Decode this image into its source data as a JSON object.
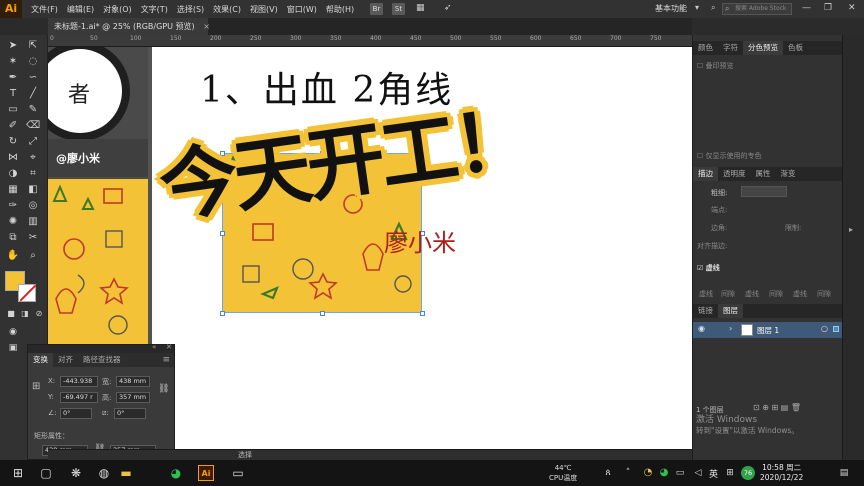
{
  "app": {
    "logo": "Ai"
  },
  "menu": [
    "文件(F)",
    "编辑(E)",
    "对象(O)",
    "文字(T)",
    "选择(S)",
    "效果(C)",
    "视图(V)",
    "窗口(W)",
    "帮助(H)"
  ],
  "menu_badges": [
    "Br",
    "St"
  ],
  "workspace": "基本功能",
  "stock_search_placeholder": "搜索 Adobe Stock",
  "document_tab": {
    "title": "未标题-1.ai* @ 25% (RGB/GPU 预览)",
    "close": "×"
  },
  "ruler_ticks": [
    "0",
    "50",
    "100",
    "150",
    "200",
    "250",
    "300",
    "350",
    "400",
    "450",
    "500",
    "550",
    "600",
    "650",
    "700",
    "750"
  ],
  "canvas": {
    "stamp_char": "者",
    "brand": "@廖小米",
    "title": "1、出血 2角线",
    "headline": "今天开工！",
    "red_text": "廖小米"
  },
  "colors": {
    "fill": "#f4c236",
    "accent": "#ff9a00",
    "layer_highlight": "#3f5a78"
  },
  "panels": {
    "top_tabs": [
      "颜色",
      "字符",
      "分色预览",
      "色板"
    ],
    "top_active": "分色预览",
    "overprint": "叠印预览",
    "spot_only": "仅显示使用的专色",
    "stroke_tabs": [
      "描边",
      "透明度",
      "属性",
      "渐变"
    ],
    "stroke_active": "描边",
    "weight_label": "粗细:",
    "cap_label": "端点:",
    "corner_label": "边角:",
    "limit_label": "限制:",
    "align_label": "对齐描边:",
    "dashed_label": "虚线",
    "dash_fields": [
      "虚线",
      "间隙",
      "虚线",
      "间隙",
      "虚线",
      "间隙"
    ],
    "layer_tabs": [
      "链接",
      "图层"
    ],
    "layer_active": "图层",
    "layer_name": "图层 1",
    "layer_count": "1 个图层"
  },
  "transform_panel": {
    "tabs": [
      "变换",
      "对齐",
      "路径查找器"
    ],
    "active": "变换",
    "x_label": "X:",
    "x_value": "-443.938",
    "y_label": "Y:",
    "y_value": "-69.497 r",
    "w_label": "宽:",
    "w_value": "438 mm",
    "h_label": "高:",
    "h_value": "357 mm",
    "angle_value": "0°",
    "shear_value": "0°",
    "rect_props": "矩形属性：",
    "rect_w": "438 mm",
    "rect_h": "357 mm"
  },
  "status": {
    "tool": "选择"
  },
  "activation": {
    "line1": "激活 Windows",
    "line2": "转到\"设置\"以激活 Windows。"
  },
  "taskbar": {
    "temp": "44℃",
    "temp_label": "CPU温度",
    "ime": "英",
    "badge": "76",
    "time": "10:58 周二",
    "date": "2020/12/22"
  }
}
